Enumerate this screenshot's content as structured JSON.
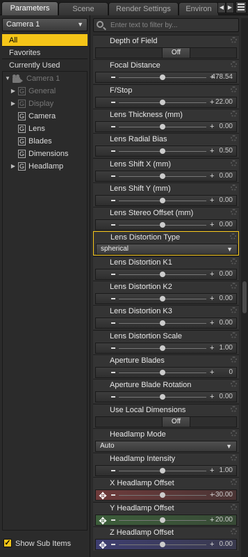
{
  "tabs": [
    "Parameters",
    "Scene",
    "Render Settings",
    "Environ"
  ],
  "tab_nav": {
    "left": "◀",
    "right": "▶"
  },
  "node_select": "Camera 1",
  "categories": [
    "All",
    "Favorites",
    "Currently Used"
  ],
  "tree": {
    "root": "Camera 1",
    "items": [
      {
        "label": "General",
        "icon": "G",
        "expandable": true,
        "dim": true
      },
      {
        "label": "Display",
        "icon": "G",
        "expandable": true,
        "dim": true
      },
      {
        "label": "Camera",
        "icon": "G",
        "expandable": false,
        "dim": false
      },
      {
        "label": "Lens",
        "icon": "G",
        "expandable": false,
        "dim": false
      },
      {
        "label": "Blades",
        "icon": "G",
        "expandable": false,
        "dim": false
      },
      {
        "label": "Dimensions",
        "icon": "G",
        "expandable": false,
        "dim": false
      },
      {
        "label": "Headlamp",
        "icon": "G",
        "expandable": true,
        "dim": false
      }
    ]
  },
  "show_sub_items": "Show Sub Items",
  "filter_placeholder": "Enter text to filter by...",
  "params": [
    {
      "label": "Depth of Field",
      "type": "toggle",
      "value": "Off"
    },
    {
      "label": "Focal Distance",
      "type": "slider",
      "value": "478.54",
      "pos": 0.5
    },
    {
      "label": "F/Stop",
      "type": "slider",
      "value": "22.00",
      "pos": 0.5
    },
    {
      "label": "Lens Thickness (mm)",
      "type": "slider",
      "value": "0.00",
      "pos": 0.5
    },
    {
      "label": "Lens Radial Bias",
      "type": "slider",
      "value": "0.50",
      "pos": 0.5
    },
    {
      "label": "Lens Shift X (mm)",
      "type": "slider",
      "value": "0.00",
      "pos": 0.5
    },
    {
      "label": "Lens Shift Y (mm)",
      "type": "slider",
      "value": "0.00",
      "pos": 0.5
    },
    {
      "label": "Lens Stereo Offset (mm)",
      "type": "slider",
      "value": "0.00",
      "pos": 0.5
    },
    {
      "label": "Lens Distortion Type",
      "type": "select",
      "value": "spherical",
      "selected": true
    },
    {
      "label": "Lens Distortion K1",
      "type": "slider",
      "value": "0.00",
      "pos": 0.5
    },
    {
      "label": "Lens Distortion K2",
      "type": "slider",
      "value": "0.00",
      "pos": 0.5
    },
    {
      "label": "Lens Distortion K3",
      "type": "slider",
      "value": "0.00",
      "pos": 0.5
    },
    {
      "label": "Lens Distortion Scale",
      "type": "slider",
      "value": "1.00",
      "pos": 0.5
    },
    {
      "label": "Aperture Blades",
      "type": "slider",
      "value": "0",
      "pos": 0.5
    },
    {
      "label": "Aperture Blade Rotation",
      "type": "slider",
      "value": "0.00",
      "pos": 0.5
    },
    {
      "label": "Use Local Dimensions",
      "type": "toggle",
      "value": "Off"
    },
    {
      "label": "Headlamp Mode",
      "type": "select",
      "value": "Auto"
    },
    {
      "label": "Headlamp Intensity",
      "type": "slider",
      "value": "1.00",
      "pos": 0.5
    },
    {
      "label": "X Headlamp Offset",
      "type": "slider",
      "value": "-30.00",
      "pos": 0.5,
      "tint": "red"
    },
    {
      "label": "Y Headlamp Offset",
      "type": "slider",
      "value": "20.00",
      "pos": 0.5,
      "tint": "green"
    },
    {
      "label": "Z Headlamp Offset",
      "type": "slider",
      "value": "0.00",
      "pos": 0.5,
      "tint": "blue"
    }
  ],
  "colors": {
    "accent": "#f5c518"
  }
}
